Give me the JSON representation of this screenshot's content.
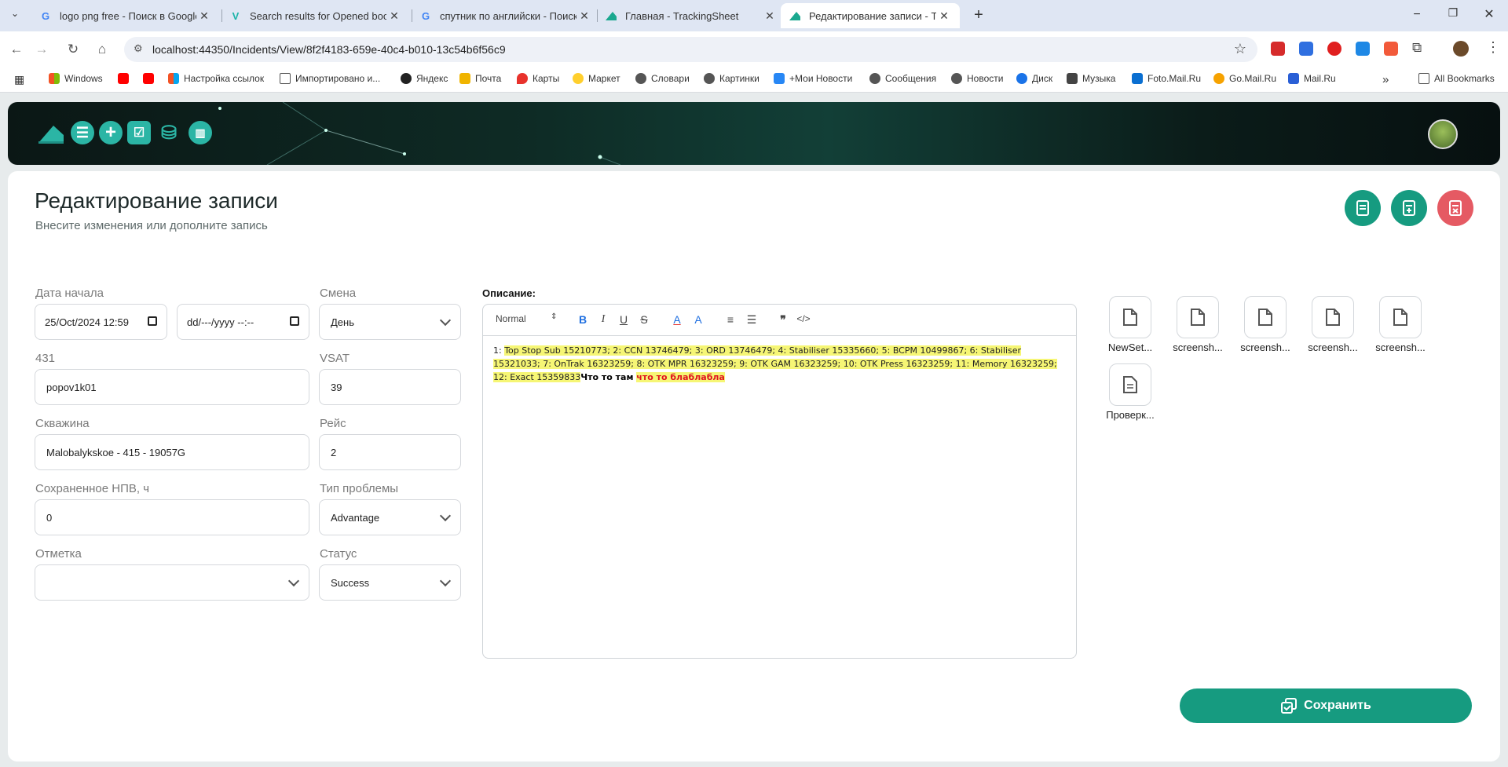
{
  "browser": {
    "tabs": [
      {
        "title": "logo png free - Поиск в Google",
        "icon": "google-icon"
      },
      {
        "title": "Search results for Opened book",
        "icon": "vector-site-icon"
      },
      {
        "title": "спутник по английски - Поиск",
        "icon": "google-icon"
      },
      {
        "title": "Главная - TrackingSheet",
        "icon": "trackingsheet-icon"
      },
      {
        "title": "Редактирование записи - Track",
        "icon": "trackingsheet-icon"
      }
    ],
    "url": "localhost:44350/Incidents/View/8f2f4183-659e-40c4-b010-13c54b6f56c9",
    "bookmarks": [
      "Windows",
      "Настройка ссылок",
      "Импортировано и...",
      "Яндекс",
      "Почта",
      "Карты",
      "Маркет",
      "Словари",
      "Картинки",
      "+Мои Новости",
      "Сообщения",
      "Новости",
      "Диск",
      "Музыка",
      "Foto.Mail.Ru",
      "Go.Mail.Ru",
      "Mail.Ru"
    ],
    "all_bookmarks": "All Bookmarks"
  },
  "page": {
    "title": "Редактирование записи",
    "subtitle": "Внесите изменения или дополните запись"
  },
  "form": {
    "start_date_label": "Дата начала",
    "start_date_value": "25/Oct/2024 12:59",
    "end_date_value": "dd/---/yyyy --:--",
    "shift_label": "Смена",
    "shift_value": "День",
    "f431_label": "431",
    "f431_value": "popov1k01",
    "vsat_label": "VSAT",
    "vsat_value": "39",
    "well_label": "Скважина",
    "well_value": "Malobalykskoe - 415 - 19057G",
    "run_label": "Рейс",
    "run_value": "2",
    "npv_label": "Сохраненное НПВ, ч",
    "npv_value": "0",
    "problem_label": "Тип проблемы",
    "problem_value": "Advantage",
    "mark_label": "Отметка",
    "mark_value": "",
    "status_label": "Статус",
    "status_value": "Success"
  },
  "editor": {
    "label": "Описание:",
    "format": "Normal",
    "text_prefix": "1: ",
    "text_highlight": "Top Stop Sub 15210773; 2: CCN 13746479; 3: ORD 13746479; 4: Stabiliser 15335660; 5: BCPM 10499867; 6: Stabiliser 15321033; 7: OnTrak 16323259; 8: OTK MPR 16323259; 9: OTK GAM 16323259; 10: OTK Press 16323259; 11: Memory 16323259; 12: Exact 15359833",
    "text_bold": "Что то там ",
    "text_red": "что то блаблабла"
  },
  "files": [
    "NewSet...",
    "screensh...",
    "screensh...",
    "screensh...",
    "screensh...",
    "Проверк..."
  ],
  "save_label": "Сохранить",
  "colors": {
    "accent": "#169b80",
    "danger": "#e55a63"
  }
}
